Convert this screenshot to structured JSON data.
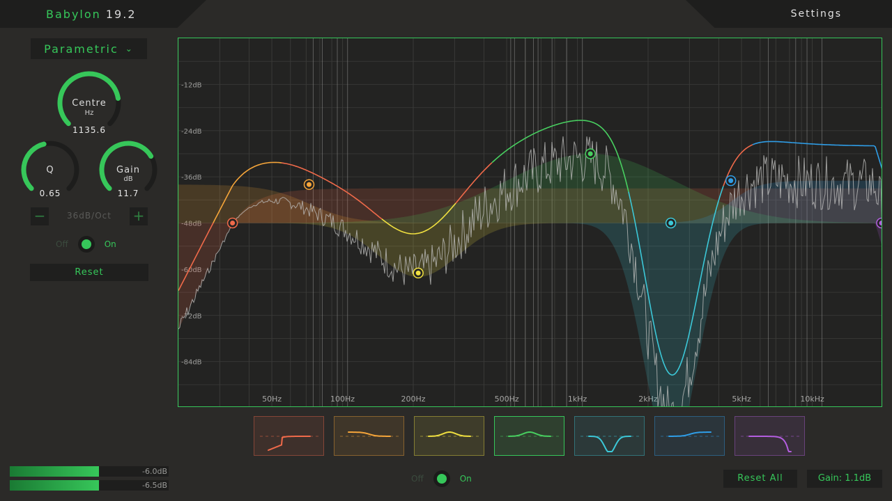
{
  "app": {
    "name": "Babylon",
    "version": "19.2",
    "settings_label": "Settings"
  },
  "left_panel": {
    "mode": "Parametric",
    "centre": {
      "label": "Centre",
      "unit": "Hz",
      "value": "1135.6",
      "level": 0.8
    },
    "q": {
      "label": "Q",
      "unit": "",
      "value": "0.65",
      "level": 0.45
    },
    "gain": {
      "label": "Gain",
      "unit": "dB",
      "value": "11.7",
      "level": 0.72
    },
    "slope": {
      "minus": "−",
      "plus": "+",
      "value": "36dB/Oct"
    },
    "toggle": {
      "off_label": "Off",
      "on_label": "On",
      "state": "on"
    },
    "reset_label": "Reset"
  },
  "meters": [
    {
      "label": "-6.0dB",
      "fill": 0.56
    },
    {
      "label": "-6.5dB",
      "fill": 0.56
    }
  ],
  "graph": {
    "db_labels": [
      "-12dB",
      "-24dB",
      "-36dB",
      "-48dB",
      "-60dB",
      "-72dB",
      "-84dB"
    ],
    "hz_labels": [
      "50Hz",
      "100Hz",
      "200Hz",
      "500Hz",
      "1kHz",
      "2kHz",
      "5kHz",
      "10kHz"
    ],
    "bands": [
      {
        "color": "#f06a4a",
        "type": "high-pass"
      },
      {
        "color": "#f5a53a",
        "type": "low-shelf"
      },
      {
        "color": "#f0e040",
        "type": "bell"
      },
      {
        "color": "#48d060",
        "type": "bell"
      },
      {
        "color": "#3cc8d8",
        "type": "notch"
      },
      {
        "color": "#2f9ee8",
        "type": "high-shelf"
      },
      {
        "color": "#b45ee0",
        "type": "low-pass"
      }
    ]
  },
  "bottom": {
    "toggle": {
      "off_label": "Off",
      "on_label": "On",
      "state": "on"
    },
    "reset_all_label": "Reset All",
    "gain_label": "Gain: 1.1dB"
  },
  "colors": {
    "accent": "#36c75a",
    "background": "#2b2a28",
    "panel": "#1f1f1e"
  }
}
